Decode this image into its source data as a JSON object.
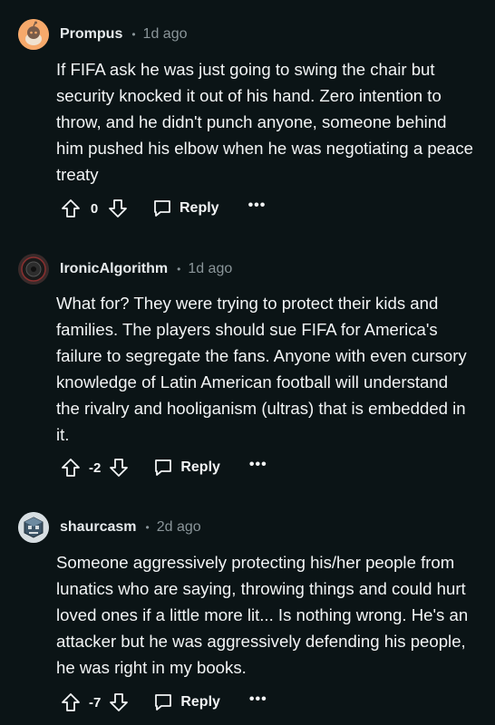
{
  "comments": [
    {
      "username": "Prompus",
      "time": "1d ago",
      "body": "If FIFA ask he was just going to swing the chair but security knocked it out of his hand. Zero intention to throw, and he didn't punch anyone, someone behind him pushed his elbow when he was negotiating a peace treaty",
      "score": "0",
      "reply_label": "Reply",
      "more_label": "•••",
      "avatar_icon": "snoo-avatar-icon",
      "avatar_color": "#f6a96b"
    },
    {
      "username": "IronicAlgorithm",
      "time": "1d ago",
      "body": "What for? They were trying to protect their kids and families. The players should sue FIFA for America's failure to segregate the fans. Anyone with even cursory knowledge of Latin American football will understand the rivalry and hooliganism (ultras) that is embedded in it.",
      "score": "-2",
      "reply_label": "Reply",
      "more_label": "•••",
      "avatar_icon": "dark-ring-avatar-icon",
      "avatar_color": "#2a2a2a"
    },
    {
      "username": "shaurcasm",
      "time": "2d ago",
      "body": "Someone aggressively protecting his/her people from lunatics who are saying, throwing things and could hurt loved ones if a little more lit... Is nothing wrong. He's an attacker but he was aggressively defending his people, he was right in my books.",
      "score": "-7",
      "reply_label": "Reply",
      "more_label": "•••",
      "avatar_icon": "cube-avatar-icon",
      "avatar_color": "#4a5a66"
    }
  ],
  "separator_dot": "•",
  "colors": {
    "background": "#0b1416",
    "text": "#f2f4f5",
    "meta": "#8a9599"
  }
}
